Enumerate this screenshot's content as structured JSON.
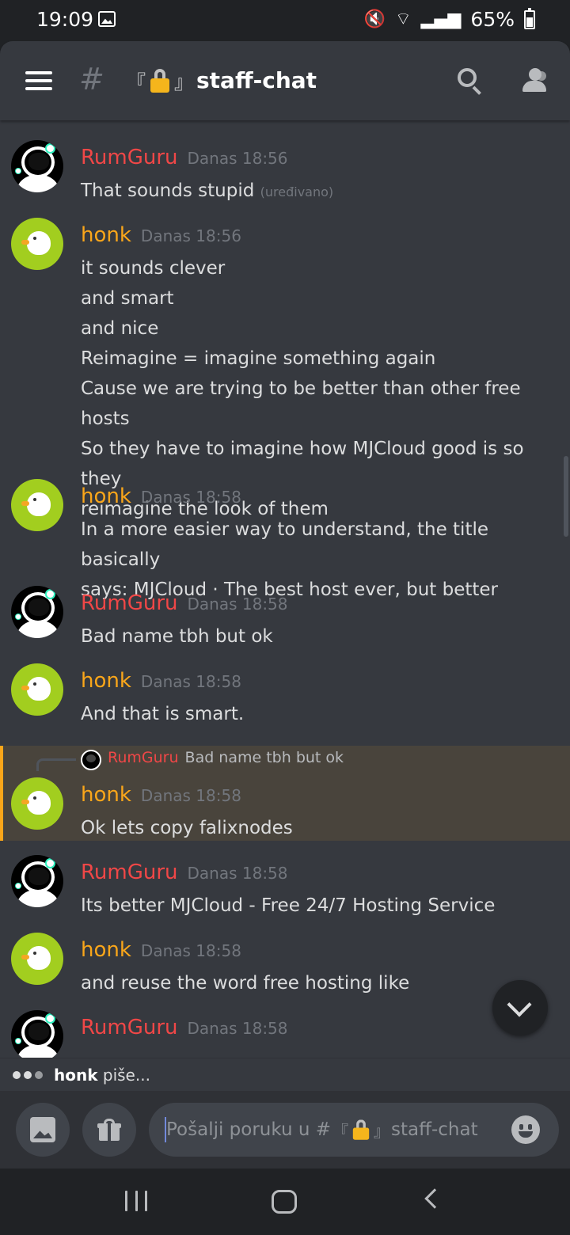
{
  "status_bar": {
    "time": "19:09",
    "battery": "65%",
    "icons": [
      "gallery-icon",
      "mute-icon",
      "wifi-icon",
      "signal-icon",
      "battery-icon"
    ]
  },
  "header": {
    "hash": "#",
    "bracket_open": "『",
    "bracket_close": "』",
    "channel_name": "staff-chat",
    "icons": [
      "menu-icon",
      "lock-icon",
      "search-icon",
      "members-icon"
    ]
  },
  "messages": [
    {
      "author": "RumGuru",
      "time": "Danas 18:56",
      "lines": [
        "That sounds stupid"
      ],
      "edited": "(uređivano)"
    },
    {
      "author": "honk",
      "time": "Danas 18:56",
      "lines": [
        "it sounds clever",
        "and smart",
        "and nice",
        "Reimagine = imagine something again",
        "Cause we are trying to be better than other free hosts",
        "So they have to imagine how MJCloud good is so they",
        "reimagine the look of them"
      ]
    },
    {
      "author": "honk",
      "time": "Danas 18:58",
      "lines": [
        "In a more easier way to understand, the title basically",
        "says: MJCloud · The best host ever, but better"
      ]
    },
    {
      "author": "RumGuru",
      "time": "Danas 18:58",
      "lines": [
        "Bad name tbh but ok"
      ]
    },
    {
      "author": "honk",
      "time": "Danas 18:58",
      "lines": [
        "And that is smart."
      ]
    },
    {
      "author": "honk",
      "time": "Danas 18:58",
      "lines": [
        "Ok lets copy falixnodes"
      ],
      "reply": {
        "author": "RumGuru",
        "text": "Bad name tbh but ok"
      }
    },
    {
      "author": "RumGuru",
      "time": "Danas 18:58",
      "lines": [
        "Its better MJCloud - Free 24/7 Hosting Service"
      ]
    },
    {
      "author": "honk",
      "time": "Danas 18:58",
      "lines": [
        "and reuse the word free hosting like"
      ]
    },
    {
      "author": "RumGuru",
      "time": "Danas 18:58",
      "lines": []
    }
  ],
  "typing": {
    "user": "honk",
    "suffix": " piše..."
  },
  "composer": {
    "placeholder_prefix": "Pošalji poruku u # ",
    "bracket_open": "『",
    "bracket_close": "』",
    "channel_name": "staff-chat",
    "icons": [
      "image-icon",
      "gift-icon",
      "emoji-icon"
    ]
  },
  "colors": {
    "rumguru": "#f04747",
    "honk": "#faa61a",
    "background": "#36393f",
    "highlight": "#49443c"
  }
}
